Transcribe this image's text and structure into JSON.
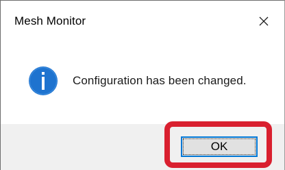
{
  "window": {
    "title": "Mesh Monitor",
    "close_icon": "close-icon"
  },
  "message": {
    "icon": "info-icon",
    "text": "Configuration has been changed."
  },
  "buttons": {
    "ok_label": "OK"
  },
  "colors": {
    "info_icon": "#1e73cf",
    "button_focus_border": "#0078d7",
    "highlight_frame": "#d9202f",
    "footer_background": "#f0f0f0"
  }
}
